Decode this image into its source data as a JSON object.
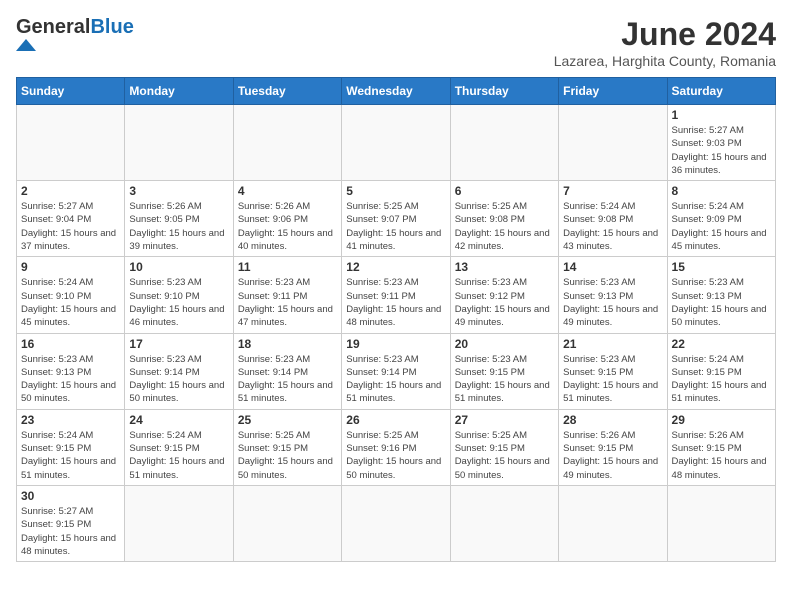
{
  "header": {
    "logo_general": "General",
    "logo_blue": "Blue",
    "month_title": "June 2024",
    "location": "Lazarea, Harghita County, Romania"
  },
  "weekdays": [
    "Sunday",
    "Monday",
    "Tuesday",
    "Wednesday",
    "Thursday",
    "Friday",
    "Saturday"
  ],
  "days": [
    {
      "date": "",
      "info": ""
    },
    {
      "date": "",
      "info": ""
    },
    {
      "date": "",
      "info": ""
    },
    {
      "date": "",
      "info": ""
    },
    {
      "date": "",
      "info": ""
    },
    {
      "date": "",
      "info": ""
    },
    {
      "date": "1",
      "info": "Sunrise: 5:27 AM\nSunset: 9:03 PM\nDaylight: 15 hours and 36 minutes."
    },
    {
      "date": "2",
      "info": "Sunrise: 5:27 AM\nSunset: 9:04 PM\nDaylight: 15 hours and 37 minutes."
    },
    {
      "date": "3",
      "info": "Sunrise: 5:26 AM\nSunset: 9:05 PM\nDaylight: 15 hours and 39 minutes."
    },
    {
      "date": "4",
      "info": "Sunrise: 5:26 AM\nSunset: 9:06 PM\nDaylight: 15 hours and 40 minutes."
    },
    {
      "date": "5",
      "info": "Sunrise: 5:25 AM\nSunset: 9:07 PM\nDaylight: 15 hours and 41 minutes."
    },
    {
      "date": "6",
      "info": "Sunrise: 5:25 AM\nSunset: 9:08 PM\nDaylight: 15 hours and 42 minutes."
    },
    {
      "date": "7",
      "info": "Sunrise: 5:24 AM\nSunset: 9:08 PM\nDaylight: 15 hours and 43 minutes."
    },
    {
      "date": "8",
      "info": "Sunrise: 5:24 AM\nSunset: 9:09 PM\nDaylight: 15 hours and 45 minutes."
    },
    {
      "date": "9",
      "info": "Sunrise: 5:24 AM\nSunset: 9:10 PM\nDaylight: 15 hours and 45 minutes."
    },
    {
      "date": "10",
      "info": "Sunrise: 5:23 AM\nSunset: 9:10 PM\nDaylight: 15 hours and 46 minutes."
    },
    {
      "date": "11",
      "info": "Sunrise: 5:23 AM\nSunset: 9:11 PM\nDaylight: 15 hours and 47 minutes."
    },
    {
      "date": "12",
      "info": "Sunrise: 5:23 AM\nSunset: 9:11 PM\nDaylight: 15 hours and 48 minutes."
    },
    {
      "date": "13",
      "info": "Sunrise: 5:23 AM\nSunset: 9:12 PM\nDaylight: 15 hours and 49 minutes."
    },
    {
      "date": "14",
      "info": "Sunrise: 5:23 AM\nSunset: 9:13 PM\nDaylight: 15 hours and 49 minutes."
    },
    {
      "date": "15",
      "info": "Sunrise: 5:23 AM\nSunset: 9:13 PM\nDaylight: 15 hours and 50 minutes."
    },
    {
      "date": "16",
      "info": "Sunrise: 5:23 AM\nSunset: 9:13 PM\nDaylight: 15 hours and 50 minutes."
    },
    {
      "date": "17",
      "info": "Sunrise: 5:23 AM\nSunset: 9:14 PM\nDaylight: 15 hours and 50 minutes."
    },
    {
      "date": "18",
      "info": "Sunrise: 5:23 AM\nSunset: 9:14 PM\nDaylight: 15 hours and 51 minutes."
    },
    {
      "date": "19",
      "info": "Sunrise: 5:23 AM\nSunset: 9:14 PM\nDaylight: 15 hours and 51 minutes."
    },
    {
      "date": "20",
      "info": "Sunrise: 5:23 AM\nSunset: 9:15 PM\nDaylight: 15 hours and 51 minutes."
    },
    {
      "date": "21",
      "info": "Sunrise: 5:23 AM\nSunset: 9:15 PM\nDaylight: 15 hours and 51 minutes."
    },
    {
      "date": "22",
      "info": "Sunrise: 5:24 AM\nSunset: 9:15 PM\nDaylight: 15 hours and 51 minutes."
    },
    {
      "date": "23",
      "info": "Sunrise: 5:24 AM\nSunset: 9:15 PM\nDaylight: 15 hours and 51 minutes."
    },
    {
      "date": "24",
      "info": "Sunrise: 5:24 AM\nSunset: 9:15 PM\nDaylight: 15 hours and 51 minutes."
    },
    {
      "date": "25",
      "info": "Sunrise: 5:25 AM\nSunset: 9:15 PM\nDaylight: 15 hours and 50 minutes."
    },
    {
      "date": "26",
      "info": "Sunrise: 5:25 AM\nSunset: 9:16 PM\nDaylight: 15 hours and 50 minutes."
    },
    {
      "date": "27",
      "info": "Sunrise: 5:25 AM\nSunset: 9:15 PM\nDaylight: 15 hours and 50 minutes."
    },
    {
      "date": "28",
      "info": "Sunrise: 5:26 AM\nSunset: 9:15 PM\nDaylight: 15 hours and 49 minutes."
    },
    {
      "date": "29",
      "info": "Sunrise: 5:26 AM\nSunset: 9:15 PM\nDaylight: 15 hours and 48 minutes."
    },
    {
      "date": "30",
      "info": "Sunrise: 5:27 AM\nSunset: 9:15 PM\nDaylight: 15 hours and 48 minutes."
    },
    {
      "date": "",
      "info": ""
    },
    {
      "date": "",
      "info": ""
    },
    {
      "date": "",
      "info": ""
    },
    {
      "date": "",
      "info": ""
    },
    {
      "date": "",
      "info": ""
    },
    {
      "date": "",
      "info": ""
    }
  ]
}
